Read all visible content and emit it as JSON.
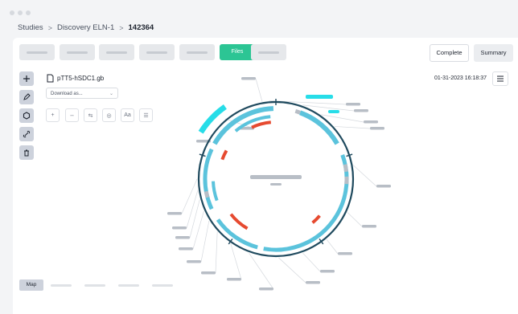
{
  "breadcrumb": {
    "items": [
      "Studies",
      "Discovery ELN-1",
      "142364"
    ],
    "separator": ">"
  },
  "toolbar": {
    "active_tab_label": "Files",
    "complete_label": "Complete",
    "summary_label": "Summary"
  },
  "file": {
    "name": "pTT5-hSDC1.gb",
    "download_placeholder": "Download as..."
  },
  "timestamp": "01-31-2023 16:18:37",
  "bottom": {
    "map_tab_label": "Map"
  },
  "colors": {
    "accent": "#2cc594",
    "backbone": "#1f4a5e",
    "feature": "#5bc3dc",
    "feature_bright": "#27dde8",
    "orf": "#e64a30",
    "placeholder": "#b8bec6"
  },
  "icons": {
    "left_tools": [
      "plus-icon",
      "pencil-icon",
      "hexagon-icon",
      "link-icon",
      "trash-icon"
    ],
    "editor_tools": [
      "plus-icon",
      "arrows-horizontal-icon",
      "swap-icon",
      "target-icon",
      "font-icon",
      "list-icon"
    ],
    "menu": "hamburger-icon",
    "file": "file-icon",
    "select": "chevron-down-icon"
  }
}
